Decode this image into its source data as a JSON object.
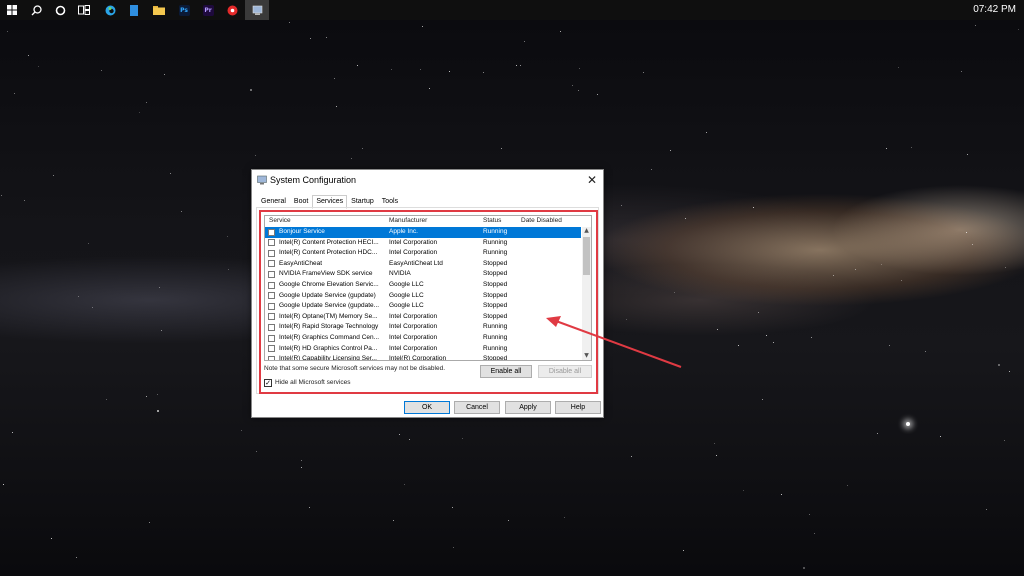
{
  "taskbar": {
    "clock": "07:42 PM",
    "icons": [
      "windows-start-icon",
      "search-icon",
      "cortana-icon",
      "task-view-icon",
      "edge-icon",
      "folder-icon",
      "photoshop-icon",
      "premiere-icon",
      "app-icon",
      "system-configuration-icon"
    ],
    "ps_label": "Ps",
    "pr_label": "Pr"
  },
  "window": {
    "title": "System Configuration",
    "close_glyph": "✕",
    "tabs": [
      {
        "label": "General"
      },
      {
        "label": "Boot"
      },
      {
        "label": "Services"
      },
      {
        "label": "Startup"
      },
      {
        "label": "Tools"
      }
    ],
    "active_tab": "Services",
    "columns": {
      "service": "Service",
      "manufacturer": "Manufacturer",
      "status": "Status",
      "date_disabled": "Date Disabled"
    },
    "services": [
      {
        "name": "Bonjour Service",
        "manufacturer": "Apple Inc.",
        "status": "Running",
        "date": ""
      },
      {
        "name": "Intel(R) Content Protection HECI...",
        "manufacturer": "Intel Corporation",
        "status": "Running",
        "date": ""
      },
      {
        "name": "Intel(R) Content Protection HDC...",
        "manufacturer": "Intel Corporation",
        "status": "Running",
        "date": ""
      },
      {
        "name": "EasyAntiCheat",
        "manufacturer": "EasyAntiCheat Ltd",
        "status": "Stopped",
        "date": ""
      },
      {
        "name": "NVIDIA FrameView SDK service",
        "manufacturer": "NVIDIA",
        "status": "Stopped",
        "date": ""
      },
      {
        "name": "Google Chrome Elevation Servic...",
        "manufacturer": "Google LLC",
        "status": "Stopped",
        "date": ""
      },
      {
        "name": "Google Update Service (gupdate)",
        "manufacturer": "Google LLC",
        "status": "Stopped",
        "date": ""
      },
      {
        "name": "Google Update Service (gupdate...",
        "manufacturer": "Google LLC",
        "status": "Stopped",
        "date": ""
      },
      {
        "name": "Intel(R) Optane(TM) Memory Se...",
        "manufacturer": "Intel Corporation",
        "status": "Stopped",
        "date": ""
      },
      {
        "name": "Intel(R) Rapid Storage Technology",
        "manufacturer": "Intel Corporation",
        "status": "Running",
        "date": ""
      },
      {
        "name": "Intel(R) Graphics Command Cen...",
        "manufacturer": "Intel Corporation",
        "status": "Running",
        "date": ""
      },
      {
        "name": "Intel(R) HD Graphics Control Pa...",
        "manufacturer": "Intel Corporation",
        "status": "Running",
        "date": ""
      },
      {
        "name": "Intel(R) Capability Licensing Ser...",
        "manufacturer": "Intel(R) Corporation",
        "status": "Stopped",
        "date": ""
      }
    ],
    "note": "Note that some secure Microsoft services may not be disabled.",
    "enable_all": "Enable all",
    "disable_all": "Disable all",
    "hide_ms_label": "Hide all Microsoft services",
    "hide_ms_checked": true,
    "hide_ms_glyph": "✓",
    "ok": "OK",
    "cancel": "Cancel",
    "apply": "Apply",
    "help": "Help",
    "scroll_up_glyph": "▲",
    "scroll_down_glyph": "▼"
  },
  "annotation": {
    "color": "#e03a43"
  }
}
